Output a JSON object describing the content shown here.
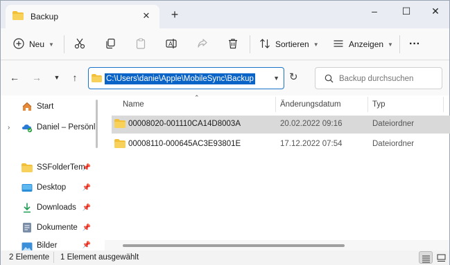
{
  "window": {
    "tab_title": "Backup",
    "new_tab_label": "+",
    "minimize_label": "–",
    "maximize_label": "☐",
    "close_label": "✕"
  },
  "toolbar": {
    "new_label": "Neu",
    "sort_label": "Sortieren",
    "view_label": "Anzeigen",
    "more_label": "···"
  },
  "address": {
    "path": "C:\\Users\\danie\\Apple\\MobileSync\\Backup",
    "search_placeholder": "Backup durchsuchen"
  },
  "sidebar": {
    "items": [
      {
        "label": "Start",
        "icon": "home-icon",
        "pinned": false
      },
      {
        "label": "Daniel – Persönl",
        "icon": "onedrive-icon",
        "pinned": false,
        "expandable": true
      },
      {
        "label": "SSFolderTem",
        "icon": "folder-icon",
        "pinned": true
      },
      {
        "label": "Desktop",
        "icon": "desktop-icon",
        "pinned": true
      },
      {
        "label": "Downloads",
        "icon": "download-icon",
        "pinned": true
      },
      {
        "label": "Dokumente",
        "icon": "document-icon",
        "pinned": true
      },
      {
        "label": "Bilder",
        "icon": "pictures-icon",
        "pinned": true
      }
    ]
  },
  "columns": {
    "name": "Name",
    "date": "Änderungsdatum",
    "type": "Typ"
  },
  "files": [
    {
      "name": "00008020-001110CA14D8003A",
      "date": "20.02.2022 09:16",
      "type": "Dateiordner",
      "selected": true
    },
    {
      "name": "00008110-000645AC3E93801E",
      "date": "17.12.2022 07:54",
      "type": "Dateiordner",
      "selected": false
    }
  ],
  "status": {
    "count": "2 Elemente",
    "selection": "1 Element ausgewählt"
  },
  "colors": {
    "accent": "#0a64c8",
    "folder": "#f2c038",
    "selected_row": "#d9d9d9"
  }
}
